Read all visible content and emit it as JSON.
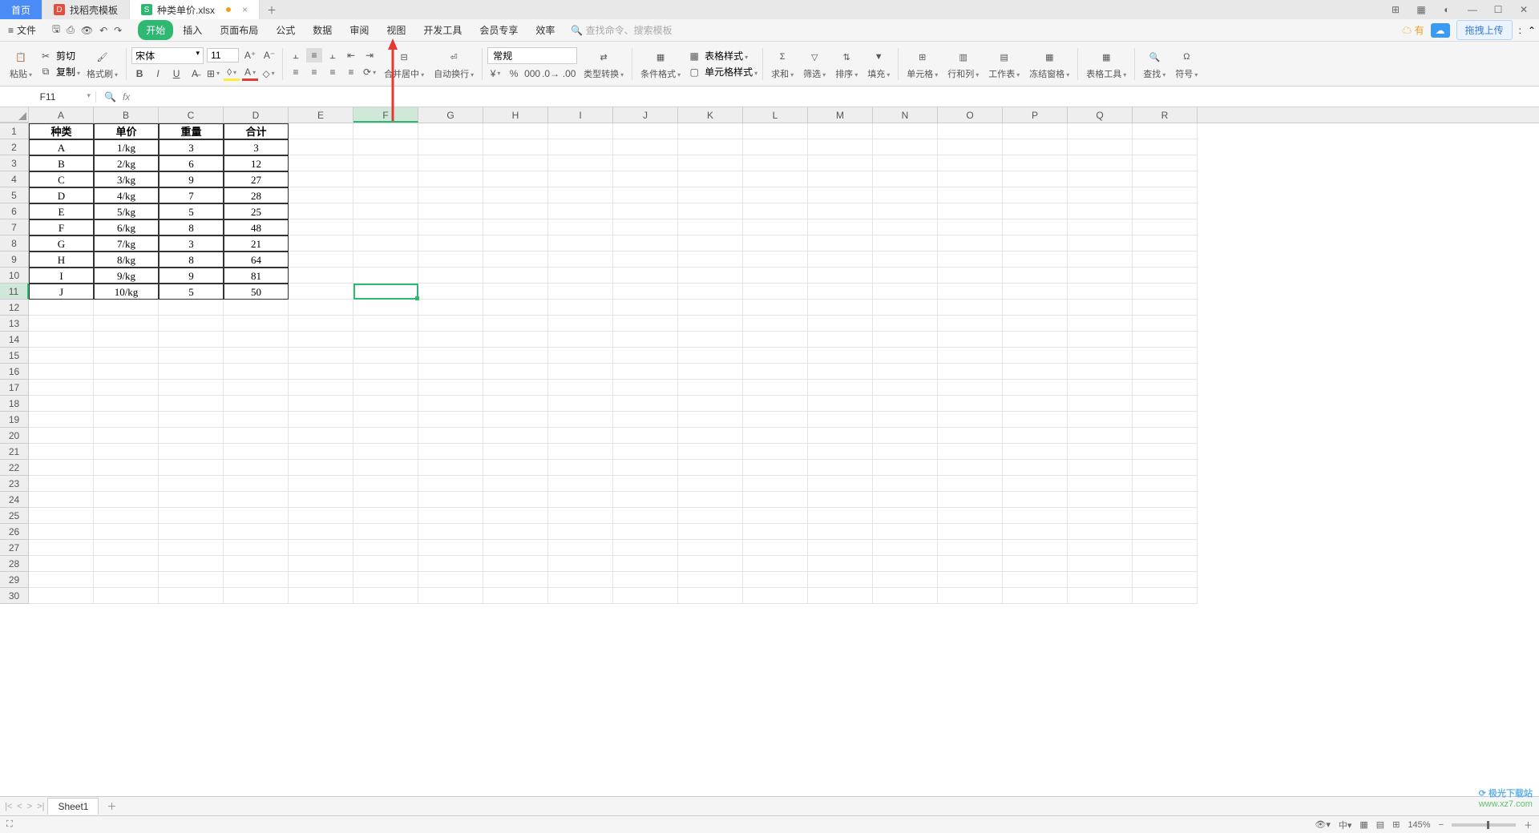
{
  "tabs": {
    "home": "首页",
    "template": "找稻壳模板",
    "current": "种类单价.xlsx"
  },
  "menu": {
    "file": "文件",
    "items": [
      "开始",
      "插入",
      "页面布局",
      "公式",
      "数据",
      "审阅",
      "视图",
      "开发工具",
      "会员专享",
      "效率"
    ],
    "search_placeholder": "查找命令、搜索模板",
    "cloud_label": "有",
    "upload": "拖拽上传"
  },
  "ribbon": {
    "paste": "粘贴",
    "cut": "剪切",
    "copy": "复制",
    "format_painter": "格式刷",
    "font_name": "宋体",
    "font_size": "11",
    "merge": "合并居中",
    "wrap": "自动换行",
    "num_format": "常规",
    "type_conv": "类型转换",
    "cond_fmt": "条件格式",
    "table_style": "表格样式",
    "cell_style": "单元格样式",
    "sum": "求和",
    "filter": "筛选",
    "sort": "排序",
    "fill": "填充",
    "cells": "单元格",
    "rowcol": "行和列",
    "worksheet": "工作表",
    "freeze": "冻结窗格",
    "table_tools": "表格工具",
    "find": "查找",
    "symbol": "符号"
  },
  "namebox": "F11",
  "columns": [
    "A",
    "B",
    "C",
    "D",
    "E",
    "F",
    "G",
    "H",
    "I",
    "J",
    "K",
    "L",
    "M",
    "N",
    "O",
    "P",
    "Q",
    "R"
  ],
  "row_count": 30,
  "selected": {
    "col_index": 5,
    "row": 11
  },
  "headers": [
    "种类",
    "单价",
    "重量",
    "合计"
  ],
  "rows": [
    [
      "A",
      "1/kg",
      "3",
      "3"
    ],
    [
      "B",
      "2/kg",
      "6",
      "12"
    ],
    [
      "C",
      "3/kg",
      "9",
      "27"
    ],
    [
      "D",
      "4/kg",
      "7",
      "28"
    ],
    [
      "E",
      "5/kg",
      "5",
      "25"
    ],
    [
      "F",
      "6/kg",
      "8",
      "48"
    ],
    [
      "G",
      "7/kg",
      "3",
      "21"
    ],
    [
      "H",
      "8/kg",
      "8",
      "64"
    ],
    [
      "I",
      "9/kg",
      "9",
      "81"
    ],
    [
      "J",
      "10/kg",
      "5",
      "50"
    ]
  ],
  "sheet": {
    "name": "Sheet1"
  },
  "status": {
    "zoom": "145%"
  },
  "watermark": {
    "line1": "极光下载站",
    "line2": "www.xz7.com"
  }
}
